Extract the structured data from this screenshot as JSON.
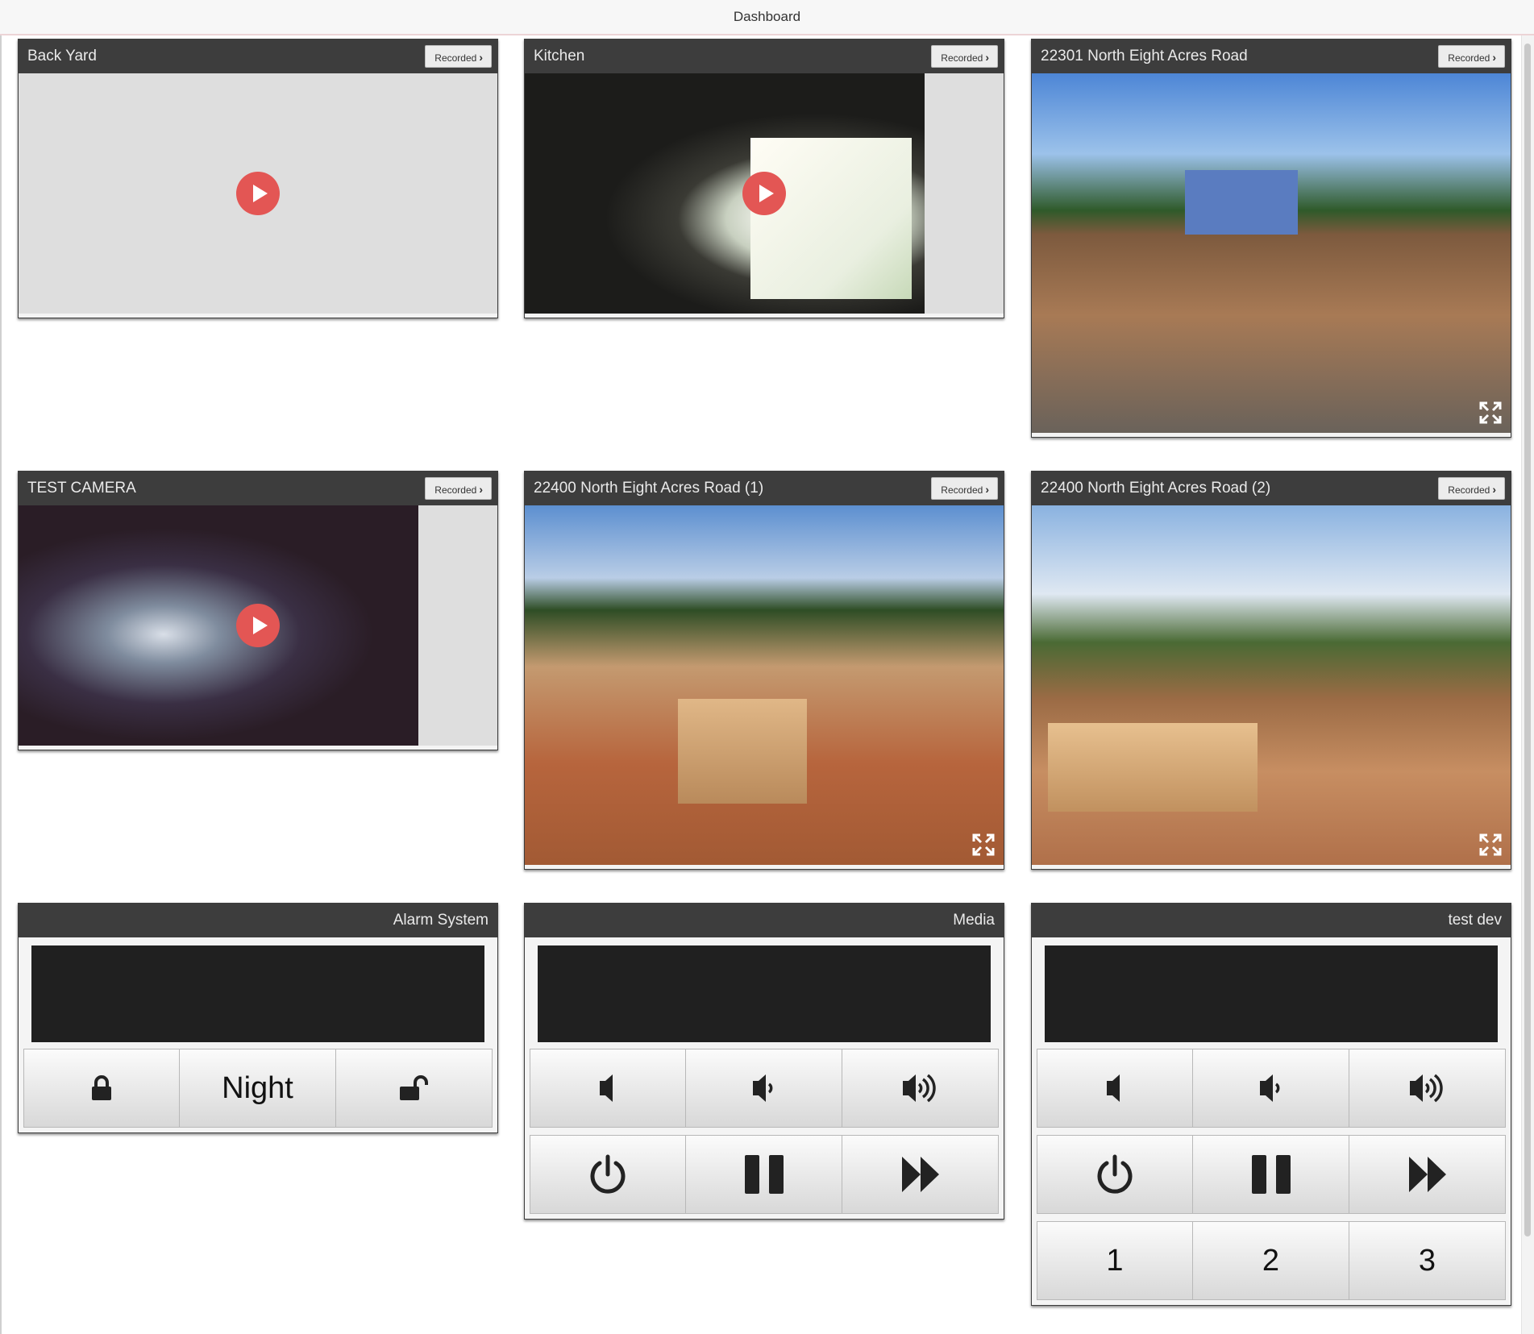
{
  "app": {
    "title": "Dashboard"
  },
  "cameras": [
    {
      "name": "Back Yard",
      "recorded_label": "Recorded"
    },
    {
      "name": "Kitchen",
      "recorded_label": "Recorded"
    },
    {
      "name": "22301 North Eight Acres Road",
      "recorded_label": "Recorded"
    },
    {
      "name": "TEST CAMERA",
      "recorded_label": "Recorded"
    },
    {
      "name": "22400 North Eight Acres Road (1)",
      "recorded_label": "Recorded"
    },
    {
      "name": "22400 North Eight Acres Road (2)",
      "recorded_label": "Recorded"
    }
  ],
  "alarm": {
    "title": "Alarm System",
    "buttons": [
      {
        "icon": "lock-icon"
      },
      {
        "label": "Night"
      },
      {
        "icon": "unlock-icon"
      }
    ]
  },
  "media": {
    "title": "Media",
    "buttons": [
      "volume-mute-icon",
      "volume-down-icon",
      "volume-up-icon",
      "power-icon",
      "pause-icon",
      "fast-forward-icon"
    ]
  },
  "testdev": {
    "title": "test dev",
    "buttons": [
      "volume-mute-icon",
      "volume-down-icon",
      "volume-up-icon",
      "power-icon",
      "pause-icon",
      "fast-forward-icon"
    ],
    "number_buttons": [
      "1",
      "2",
      "3"
    ]
  },
  "colors": {
    "header": "#3d3d3d",
    "play": "#e35654",
    "screen": "#202020"
  }
}
